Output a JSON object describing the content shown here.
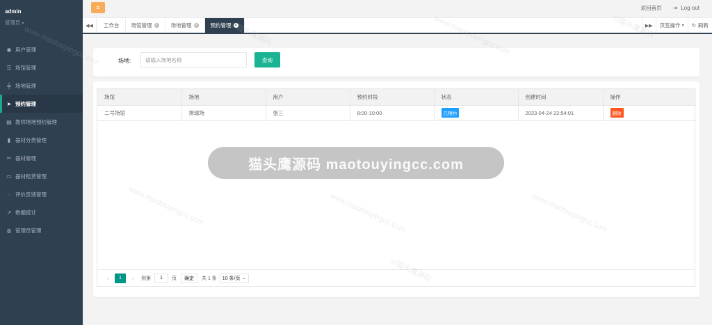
{
  "sidebar": {
    "user_name": "admin",
    "role": "管理员",
    "items": [
      {
        "label": "用户管理",
        "icon": "user-circle-icon"
      },
      {
        "label": "场馆管理",
        "icon": "sliders-icon"
      },
      {
        "label": "场地管理",
        "icon": "grid-icon"
      },
      {
        "label": "预约管理",
        "icon": "send-icon",
        "active": true
      },
      {
        "label": "教师场地预约管理",
        "icon": "id-card-icon"
      },
      {
        "label": "器材分类管理",
        "icon": "bookmark-icon"
      },
      {
        "label": "器材管理",
        "icon": "tools-icon"
      },
      {
        "label": "器材租赁管理",
        "icon": "credit-card-icon"
      },
      {
        "label": "评价反馈管理",
        "icon": "comment-icon"
      },
      {
        "label": "数据统计",
        "icon": "chart-line-icon"
      },
      {
        "label": "管理员管理",
        "icon": "user-admin-icon"
      }
    ]
  },
  "topbar": {
    "home_link": "返回首页",
    "logout": "Log out"
  },
  "tabs": {
    "items": [
      {
        "label": "工作台",
        "closable": false
      },
      {
        "label": "场馆管理",
        "closable": true
      },
      {
        "label": "场地管理",
        "closable": true
      },
      {
        "label": "预约管理",
        "closable": true,
        "active": true
      }
    ],
    "page_ops": "页签操作",
    "refresh": "刷新"
  },
  "search": {
    "label": "场地:",
    "placeholder": "请输入场地名称",
    "button": "查询"
  },
  "table": {
    "columns": [
      "场馆",
      "场地",
      "用户",
      "预约时段",
      "状态",
      "创建时间",
      "操作"
    ],
    "rows": [
      {
        "venue": "二号场馆",
        "field": "排球场",
        "user": "张三",
        "slot": "8:00-10:00",
        "status": "已预约",
        "created": "2023-04-24 22:54:01",
        "action": "删除"
      }
    ]
  },
  "pager": {
    "current": "1",
    "goto_label": "到第",
    "page_input": "1",
    "page_unit": "页",
    "confirm": "确定",
    "total": "共 1 条",
    "page_size": "10 条/页"
  },
  "watermark": {
    "banner": "猫头鹰源码 maotouyingcc.com",
    "tile_a": "www.maotouyingcc.com",
    "tile_b": "©猫头鹰源码"
  },
  "colors": {
    "sidebar_bg": "#2f4050",
    "accent_green": "#1ab394",
    "pager_teal": "#009688",
    "status_blue": "#1e9fff",
    "delete_orange": "#ff5722",
    "menu_orange": "#f8ac59"
  }
}
